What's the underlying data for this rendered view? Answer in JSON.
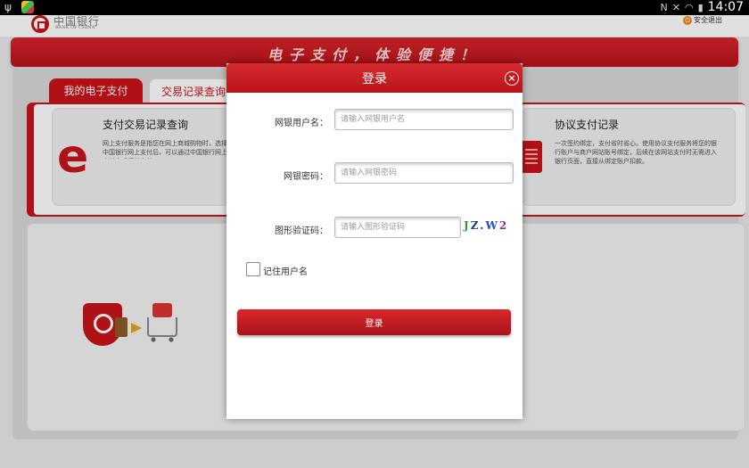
{
  "status_bar": {
    "time": "14:07",
    "icons": [
      "usb-icon",
      "app-icon",
      "mute-icon",
      "nfc-icon",
      "wifi-icon",
      "battery-icon"
    ]
  },
  "header": {
    "bank_name_cn": "中国银行",
    "bank_name_en": "BANK OF CHINA",
    "logout_label": "安全退出"
  },
  "banner": {
    "slogan": "电子支付，体验便捷！"
  },
  "tabs": [
    {
      "label": "我的电子支付",
      "active": true
    },
    {
      "label": "交易记录查询",
      "active": false
    }
  ],
  "cards": {
    "left": {
      "title": "支付交易记录查询",
      "desc": "网上支付服务是指您在网上商城购物时，选择中国银行网上支付后，可以通过中国银行网上支付完成订单支付。"
    },
    "right": {
      "title": "协议支付记录",
      "desc": "一次签约绑定，支付省时省心。使用协议支付服务将您的银行账户与商户网站账号绑定，后续在该网站支付时无需进入银行页面，直接从绑定账户扣款。"
    }
  },
  "dialog": {
    "title": "登录",
    "close_label": "×",
    "username": {
      "label": "网银用户名：",
      "placeholder": "请输入网银用户名",
      "value": ""
    },
    "password": {
      "label": "网银密码：",
      "placeholder": "请输入网银密码",
      "value": ""
    },
    "captcha": {
      "label": "图形验证码：",
      "placeholder": "请输入图形验证码",
      "value": "",
      "image_text": [
        "J",
        "Z",
        ".",
        "W",
        "2"
      ]
    },
    "remember_label": "记住用户名",
    "remember_checked": false,
    "submit_label": "登录"
  },
  "colors": {
    "brand_red": "#c8141b",
    "banner_text": "#fbd9da"
  }
}
